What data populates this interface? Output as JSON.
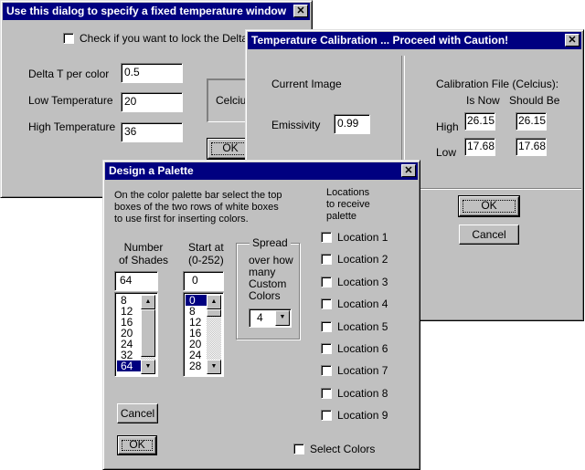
{
  "fixed_window": {
    "title": "Use this dialog to specify a fixed temperature window",
    "lock_checkbox_label": "Check if you want to lock the Delta T",
    "lock_checked": false,
    "delta_label": "Delta T per color",
    "delta_value": "0.5",
    "low_label": "Low Temperature",
    "low_value": "20",
    "high_label": "High Temperature",
    "high_value": "36",
    "unit_label": "Celcius",
    "ok_label": "OK"
  },
  "calibration": {
    "title": "Temperature Calibration ... Proceed with Caution!",
    "current_image_label": "Current Image",
    "emissivity_label": "Emissivity",
    "emissivity_value": "0.99",
    "calibration_file_label": "Calibration File (Celcius):",
    "col_is_now": "Is Now",
    "col_should_be": "Should Be",
    "high_label": "High",
    "high_is_now": "26.15",
    "high_should_be": "26.15",
    "low_label": "Low",
    "low_is_now": "17.68",
    "low_should_be": "17.68",
    "ok_label": "OK",
    "cancel_label": "Cancel"
  },
  "palette": {
    "title": "Design a Palette",
    "instructions": [
      "On the color palette bar select the top",
      "boxes of the two rows of white boxes",
      "to use first for inserting colors."
    ],
    "shades_header": [
      "Number",
      "of Shades"
    ],
    "shades_value": "64",
    "shades_options": [
      "8",
      "12",
      "16",
      "20",
      "24",
      "32",
      "64"
    ],
    "shades_selected": "64",
    "start_header": [
      "Start at",
      "(0-252)"
    ],
    "start_value": "0",
    "start_options": [
      "0",
      "8",
      "12",
      "16",
      "20",
      "24",
      "28"
    ],
    "start_selected": "0",
    "spread_group_label": "Spread",
    "spread_text": [
      "over how",
      "many",
      "Custom",
      "Colors"
    ],
    "spread_value": "4",
    "locations_header": [
      "Locations",
      "to receive",
      "palette"
    ],
    "locations": [
      "Location 1",
      "Location 2",
      "Location 3",
      "Location 4",
      "Location 5",
      "Location 6",
      "Location 7",
      "Location 8",
      "Location 9"
    ],
    "select_colors_label": "Select Colors",
    "cancel_label": "Cancel",
    "ok_label": "OK"
  },
  "icons": {
    "close": "✕",
    "arrow_up": "▲",
    "arrow_down": "▼"
  }
}
